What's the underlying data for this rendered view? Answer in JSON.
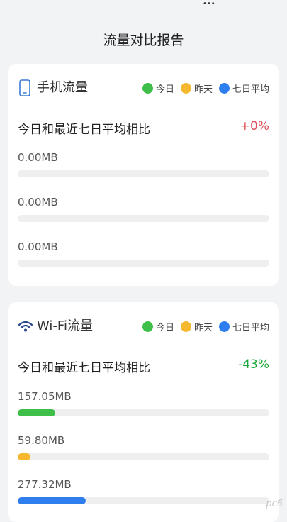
{
  "colors": {
    "today": "#3dbf4a",
    "yesterday": "#f5b82e",
    "week_avg": "#2f7ef0",
    "increase": "#e0505a",
    "decrease": "#1fa83a"
  },
  "header": {
    "title": "流量对比报告",
    "status_fragment": "•••"
  },
  "legend": {
    "today": "今日",
    "yesterday": "昨天",
    "week_avg": "七日平均"
  },
  "mobile": {
    "icon": "phone-icon",
    "title": "手机流量",
    "compare_label": "今日和最近七日平均相比",
    "compare_value": "+0%",
    "metrics": [
      {
        "series": "today",
        "value": "0.00MB",
        "fill_fraction": 0
      },
      {
        "series": "yesterday",
        "value": "0.00MB",
        "fill_fraction": 0
      },
      {
        "series": "week_avg",
        "value": "0.00MB",
        "fill_fraction": 0
      }
    ]
  },
  "wifi": {
    "icon": "wifi-icon",
    "title": "Wi-Fi流量",
    "compare_label": "今日和最近七日平均相比",
    "compare_value": "-43%",
    "metrics": [
      {
        "series": "today",
        "value": "157.05MB",
        "fill_fraction": 0.15
      },
      {
        "series": "yesterday",
        "value": "59.80MB",
        "fill_fraction": 0.05
      },
      {
        "series": "week_avg",
        "value": "277.32MB",
        "fill_fraction": 0.27
      }
    ]
  },
  "watermark": "pc6"
}
